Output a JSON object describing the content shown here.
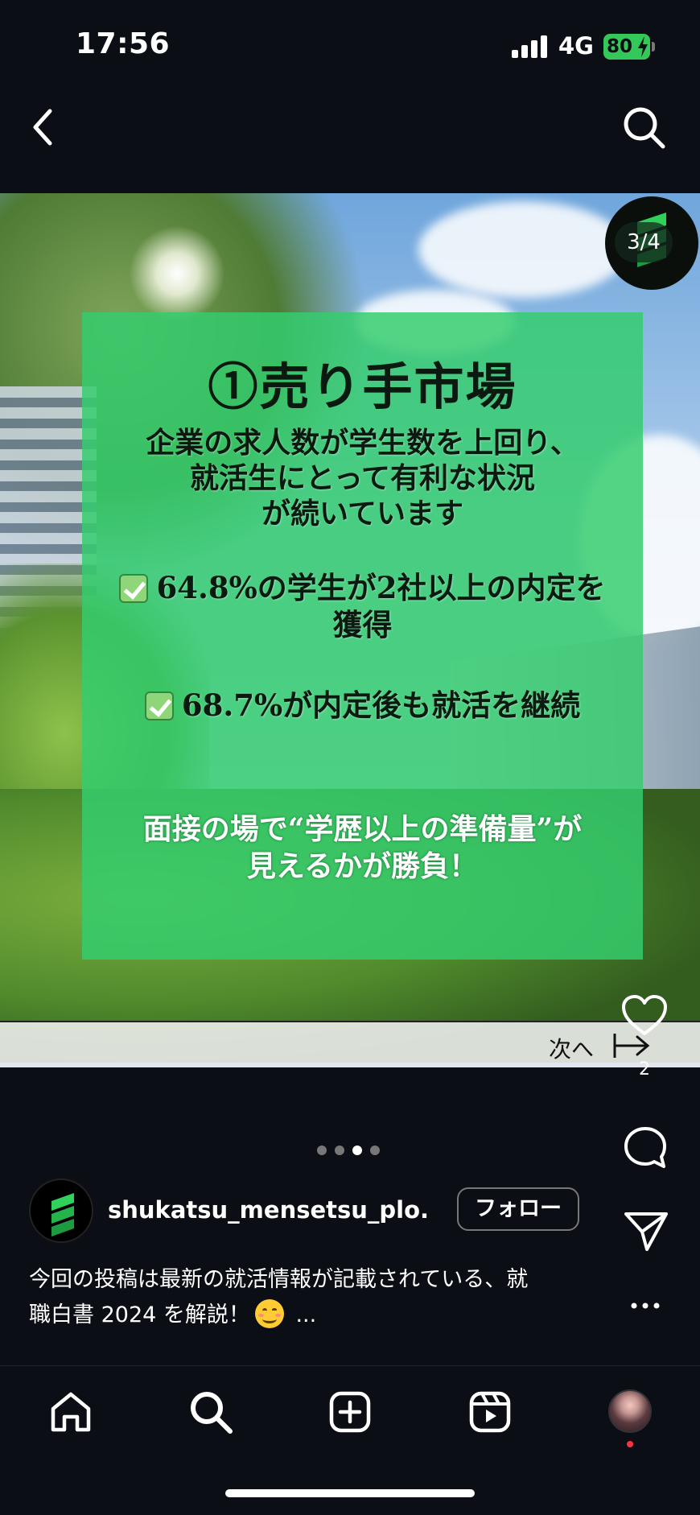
{
  "status_bar": {
    "time": "17:56",
    "network": "4G",
    "battery": "80"
  },
  "post": {
    "page_counter": "3/4",
    "title": "①売り手市場",
    "intro_lines": [
      "企業の求人数が学生数を上回り、",
      "就活生にとって有利な状況",
      "が続いています"
    ],
    "stat1_line1": "64.8%の学生が2社以上の内定を",
    "stat1_line2": "獲得",
    "stat2": "68.7%が内定後も就活を継続",
    "closing_lines": [
      "面接の場で“学歴以上の準備量”が",
      "見えるかが勝負！"
    ],
    "next_label": "次へ"
  },
  "actions": {
    "like_count": "2"
  },
  "account": {
    "username": "shukatsu_mensetsu_plo...",
    "follow_label": "フォロー"
  },
  "caption": {
    "line1": "今回の投稿は最新の就活情報が記載されている、就",
    "line2_before": "職白書 2024 を解説！",
    "line2_after": " ..."
  },
  "carousel": {
    "total": 4,
    "active": 3
  },
  "icons": {
    "back": "chevron-left-icon",
    "search": "search-icon",
    "like": "heart-icon",
    "comment": "comment-icon",
    "share": "send-icon",
    "more": "more-icon",
    "home": "home-icon",
    "create": "plus-square-icon",
    "reels": "reels-icon"
  },
  "colors": {
    "background": "#0b0e14",
    "panel_green": "#34cd6e",
    "battery_green": "#34c759",
    "notification_red": "#ff3040"
  }
}
